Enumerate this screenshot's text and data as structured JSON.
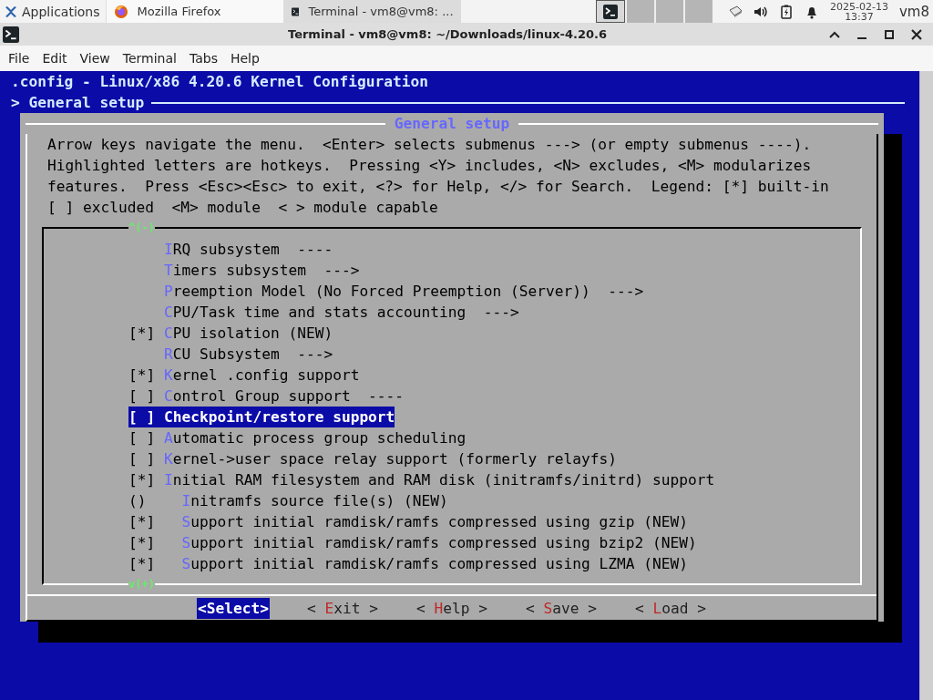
{
  "top_panel": {
    "applications": "Applications",
    "tasks": [
      {
        "kind": "browser",
        "title": "Mozilla Firefox",
        "selected": false
      },
      {
        "kind": "terminal",
        "title": "Terminal - vm8@vm8: ...",
        "selected": true
      }
    ],
    "workspaces": [
      {
        "selected": true
      },
      {
        "selected": false
      },
      {
        "selected": false
      },
      {
        "selected": false
      }
    ],
    "clock": {
      "date": "2025-02-13",
      "time": "13:37"
    },
    "user": "vm8"
  },
  "window": {
    "title": "Terminal - vm8@vm8: ~/Downloads/linux-4.20.6"
  },
  "menu": [
    "File",
    "Edit",
    "View",
    "Terminal",
    "Tabs",
    "Help"
  ],
  "terminal": {
    "header": ".config - Linux/x86 4.20.6 Kernel Configuration",
    "breadcrumb": "> General setup",
    "dialog": {
      "title": "General setup",
      "help": [
        "Arrow keys navigate the menu.  <Enter> selects submenus ---> (or empty submenus ----).",
        "Highlighted letters are hotkeys.  Pressing <Y> includes, <N> excludes, <M> modularizes",
        "features.  Press <Esc><Esc> to exit, <?> for Help, </> for Search.  Legend: [*] built-in",
        "[ ] excluded  <M> module  < > module capable"
      ],
      "scroll_up": "^(-)",
      "scroll_down": "v(+)",
      "items": [
        {
          "label": "IRQ subsystem  ----",
          "selected": false
        },
        {
          "label": "Timers subsystem  --->",
          "selected": false
        },
        {
          "label": "Preemption Model (No Forced Preemption (Server))  --->",
          "selected": false
        },
        {
          "label": "CPU/Task time and stats accounting  --->",
          "selected": false
        },
        {
          "prefix": "[*]",
          "label": "CPU isolation (NEW)",
          "selected": false
        },
        {
          "label": "RCU Subsystem  --->",
          "selected": false
        },
        {
          "prefix": "[*]",
          "label": "Kernel .config support",
          "selected": false
        },
        {
          "prefix": "[ ]",
          "label": "Control Group support  ----",
          "selected": false
        },
        {
          "prefix": "[ ]",
          "label": "Checkpoint/restore support",
          "selected": true
        },
        {
          "prefix": "[ ]",
          "label": "Automatic process group scheduling",
          "selected": false
        },
        {
          "prefix": "[ ]",
          "label": "Kernel->user space relay support (formerly relayfs)",
          "selected": false
        },
        {
          "prefix": "[*]",
          "label": "Initial RAM filesystem and RAM disk (initramfs/initrd) support",
          "selected": false,
          "children": [
            {
              "prefix": "()",
              "label": "Initramfs source file(s) (NEW)",
              "selected": false
            },
            {
              "prefix": "[*]",
              "label": "Support initial ramdisk/ramfs compressed using gzip (NEW)",
              "selected": false
            },
            {
              "prefix": "[*]",
              "label": "Support initial ramdisk/ramfs compressed using bzip2 (NEW)",
              "selected": false
            },
            {
              "prefix": "[*]",
              "label": "Support initial ramdisk/ramfs compressed using LZMA (NEW)",
              "selected": false
            }
          ]
        }
      ],
      "buttons": [
        {
          "label": "<Select>",
          "selected": true
        },
        {
          "label": "< Exit >",
          "selected": false
        },
        {
          "label": "< Help >",
          "selected": false
        },
        {
          "label": "< Save >",
          "selected": false
        },
        {
          "label": "< Load >",
          "selected": false
        }
      ]
    }
  }
}
